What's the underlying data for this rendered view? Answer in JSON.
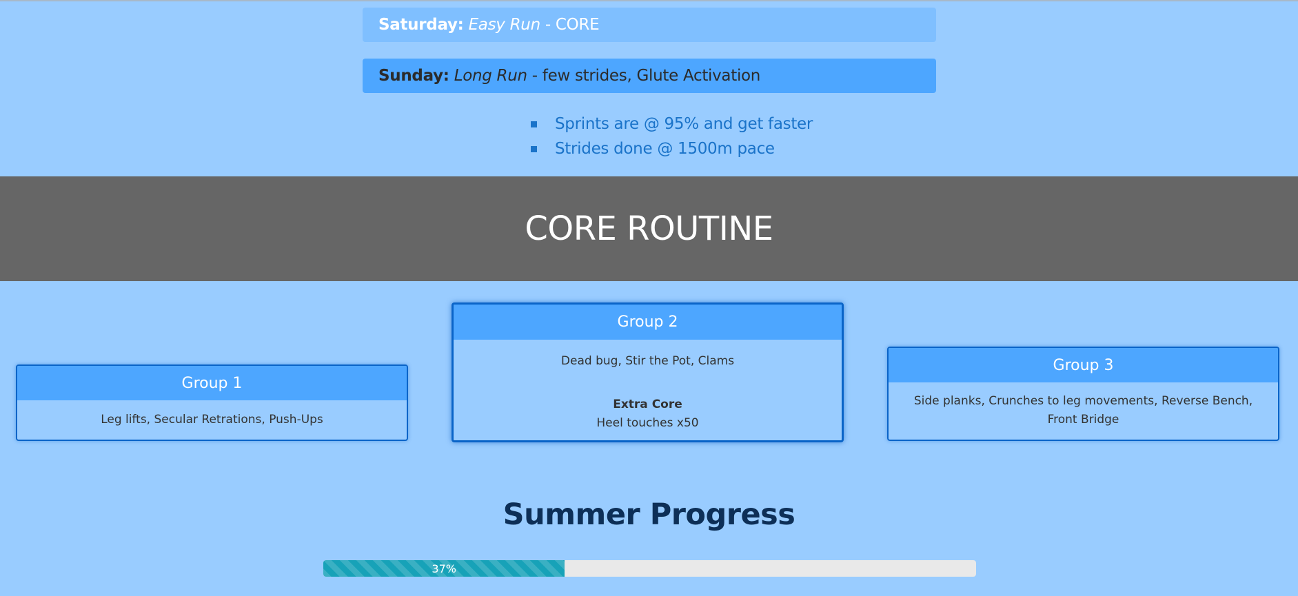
{
  "schedule": {
    "saturday": {
      "day": "Saturday:",
      "workout": "Easy Run",
      "separator": "-",
      "extra": "CORE"
    },
    "sunday": {
      "day": "Sunday:",
      "workout": "Long Run",
      "separator": "-",
      "extra": "few strides, Glute Activation"
    }
  },
  "notes": [
    "Sprints are @ 95% and get faster",
    "Strides done @ 1500m pace"
  ],
  "core_section": {
    "title": "CORE ROUTINE"
  },
  "groups": [
    {
      "title": "Group 1",
      "exercises": "Leg lifts, Secular Retrations, Push-Ups"
    },
    {
      "title": "Group 2",
      "exercises": "Dead bug, Stir the Pot, Clams",
      "extra_title": "Extra Core",
      "extra_detail": "Heel touches x50"
    },
    {
      "title": "Group 3",
      "exercises": "Side planks, Crunches to leg movements, Reverse Bench, Front Bridge"
    }
  ],
  "progress": {
    "title": "Summer Progress",
    "value": 37,
    "label": "37%",
    "color": "#17a2b8"
  },
  "colors": {
    "background": "#99ccff",
    "band": "#666666",
    "card_header": "#4da6ff",
    "card_border": "#0a64c8"
  }
}
